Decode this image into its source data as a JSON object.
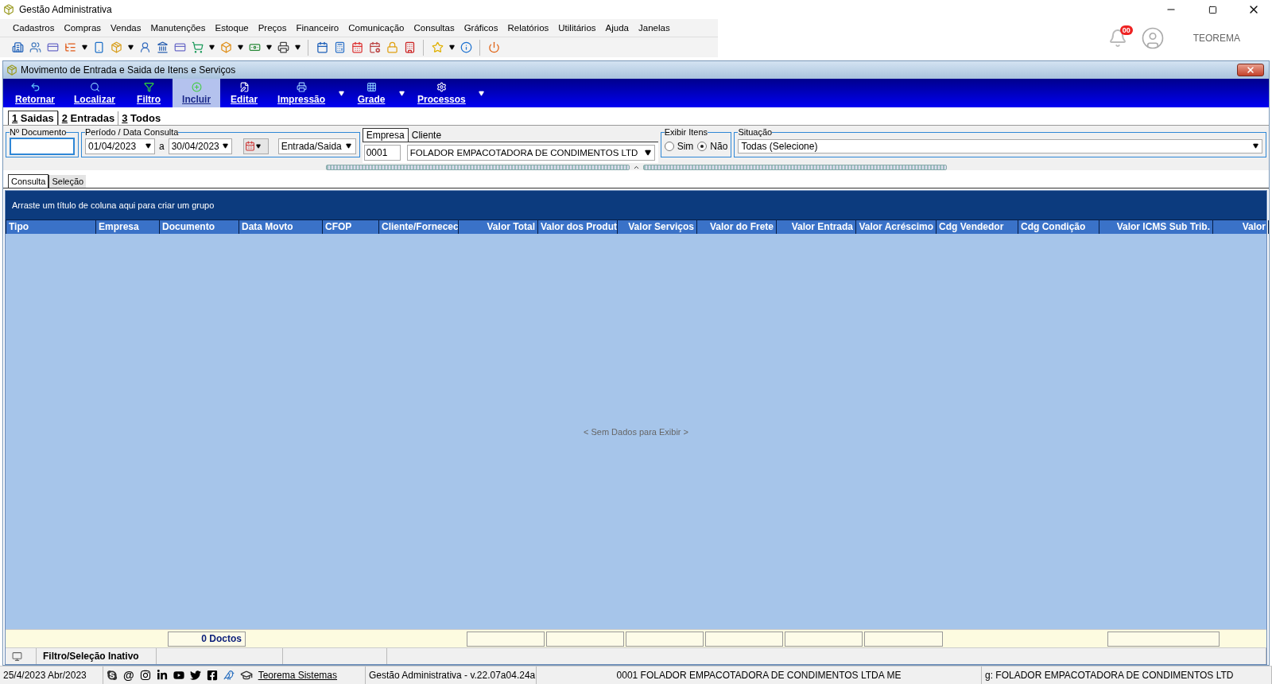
{
  "app": {
    "title": "Gestão Administrativa",
    "menu": [
      "Cadastros",
      "Compras",
      "Vendas",
      "Manutenções",
      "Estoque",
      "Preços",
      "Financeiro",
      "Comunicação",
      "Consultas",
      "Gráficos",
      "Relatórios",
      "Utilitários",
      "Ajuda",
      "Janelas"
    ],
    "notification_count": "00",
    "user": "TEOREMA"
  },
  "window": {
    "title": "Movimento de Entrada e Saida de Itens e Serviços",
    "toolbar": [
      {
        "label": "Retornar",
        "has_menu": false,
        "hovered": false
      },
      {
        "label": "Localizar",
        "has_menu": false,
        "hovered": false
      },
      {
        "label": "Filtro",
        "has_menu": false,
        "hovered": false
      },
      {
        "label": "Incluir",
        "has_menu": false,
        "hovered": true
      },
      {
        "label": "Editar",
        "has_menu": false,
        "hovered": false
      },
      {
        "label": "Impressão",
        "has_menu": true,
        "hovered": false
      },
      {
        "label": "Grade",
        "has_menu": true,
        "hovered": false
      },
      {
        "label": "Processos",
        "has_menu": true,
        "hovered": false
      }
    ],
    "mode_tabs": [
      {
        "label": "1 Saidas",
        "selected": true
      },
      {
        "label": "2 Entradas",
        "selected": false
      },
      {
        "label": "3 Todos",
        "selected": false
      }
    ],
    "filters": {
      "documento": {
        "label": "Nº Documento"
      },
      "periodo": {
        "label": "Período / Data Consulta",
        "from": "01/04/2023",
        "separator": "a",
        "to": "30/04/2023",
        "type": "Entrada/Saida"
      },
      "party_tabs": [
        {
          "label": "Empresa",
          "selected": true
        },
        {
          "label": "Cliente",
          "selected": false
        }
      ],
      "empresa_code": "0001",
      "cliente": "FOLADOR EMPACOTADORA DE CONDIMENTOS LTD",
      "exibir_itens": {
        "label": "Exibir Itens",
        "options": [
          {
            "label": "Sim",
            "selected": false
          },
          {
            "label": "Não",
            "selected": true
          }
        ]
      },
      "situacao": {
        "label": "Situação",
        "value": "Todas (Selecione)"
      }
    },
    "view_tabs": [
      {
        "label": "Consulta",
        "selected": true
      },
      {
        "label": "Seleção",
        "selected": false
      }
    ],
    "grid": {
      "group_hint": "Arraste um título de coluna aqui para criar um grupo",
      "columns": [
        {
          "label": "Tipo",
          "kind": "text",
          "footer_cell": false
        },
        {
          "label": "Empresa",
          "kind": "text",
          "footer_cell": false
        },
        {
          "label": "Documento",
          "kind": "text",
          "footer_cell": true,
          "footer": "0 Doctos"
        },
        {
          "label": "Data Movto",
          "kind": "text",
          "footer_cell": false
        },
        {
          "label": "CFOP",
          "kind": "text",
          "footer_cell": false
        },
        {
          "label": "Cliente/Fornecec",
          "kind": "text",
          "footer_cell": false
        },
        {
          "label": "Valor Total",
          "kind": "number",
          "footer_cell": true
        },
        {
          "label": "Valor dos Produt",
          "kind": "text",
          "footer_cell": true
        },
        {
          "label": "Valor Serviços",
          "kind": "number",
          "footer_cell": true
        },
        {
          "label": "Valor do Frete",
          "kind": "number",
          "footer_cell": true
        },
        {
          "label": "Valor Entrada",
          "kind": "number",
          "footer_cell": true
        },
        {
          "label": "Valor Acréscimo",
          "kind": "number",
          "footer_cell": true
        },
        {
          "label": "Cdg Vendedor",
          "kind": "text",
          "footer_cell": false
        },
        {
          "label": "Cdg Condição",
          "kind": "text",
          "footer_cell": false
        },
        {
          "label": "Valor ICMS Sub Trib.",
          "kind": "number",
          "footer_cell": true
        },
        {
          "label": "Valor",
          "kind": "number",
          "footer_cell": false
        }
      ],
      "empty_text": "< Sem Dados para Exibir >"
    },
    "status": "Filtro/Seleção Inativo"
  },
  "status_bar": {
    "date": "25/4/2023 Abr/2023",
    "at": "@",
    "link": "Teorema Sistemas",
    "version": "Gestão Administrativa - v.22.07a04.24a",
    "company": "0001 FOLADOR EMPACOTADORA DE CONDIMENTOS LTDA ME",
    "extra": "g: FOLADOR EMPACOTADORA DE CONDIMENTOS LTD"
  }
}
